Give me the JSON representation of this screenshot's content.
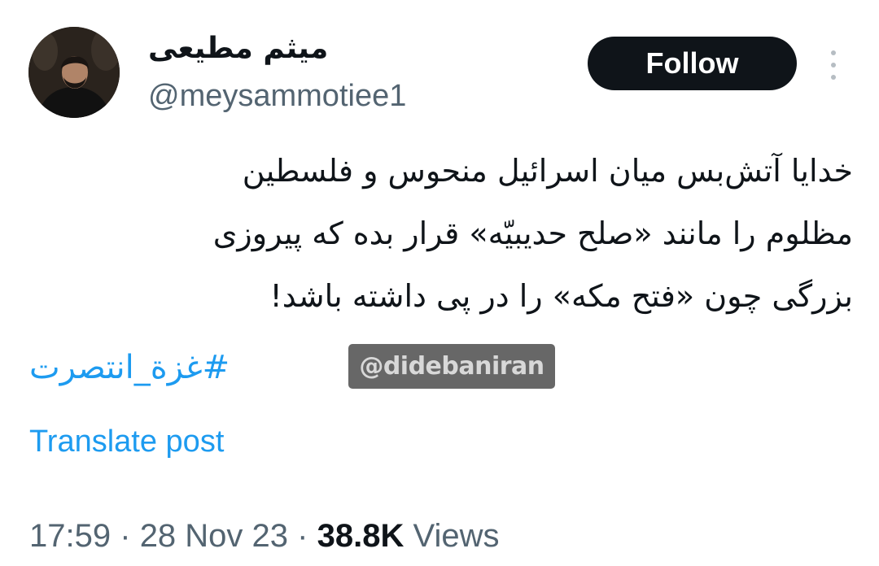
{
  "author": {
    "display_name": "میثم مطیعی",
    "handle": "@meysammotiee1"
  },
  "header": {
    "follow_label": "Follow",
    "more_icon": "more-vertical-icon"
  },
  "tweet": {
    "lines": [
      "خدایا آتش‌بس میان اسرائیل منحوس و فلسطین",
      "مظلوم را مانند «صلح حدیبیّه» قرار بده که پیروزی",
      "بزرگی چون «فتح مکه» را در پی داشته باشد!"
    ],
    "hashtag": "#غزة_انتصرت",
    "watermark": "@didebaniran",
    "translate_label": "Translate post"
  },
  "meta": {
    "time": "17:59",
    "separator": "·",
    "date": "28 Nov 23",
    "views_count": "38.8K",
    "views_label": "Views"
  },
  "colors": {
    "link": "#1d9bf0",
    "secondary_text": "#536471",
    "button_bg": "#0f1419"
  }
}
